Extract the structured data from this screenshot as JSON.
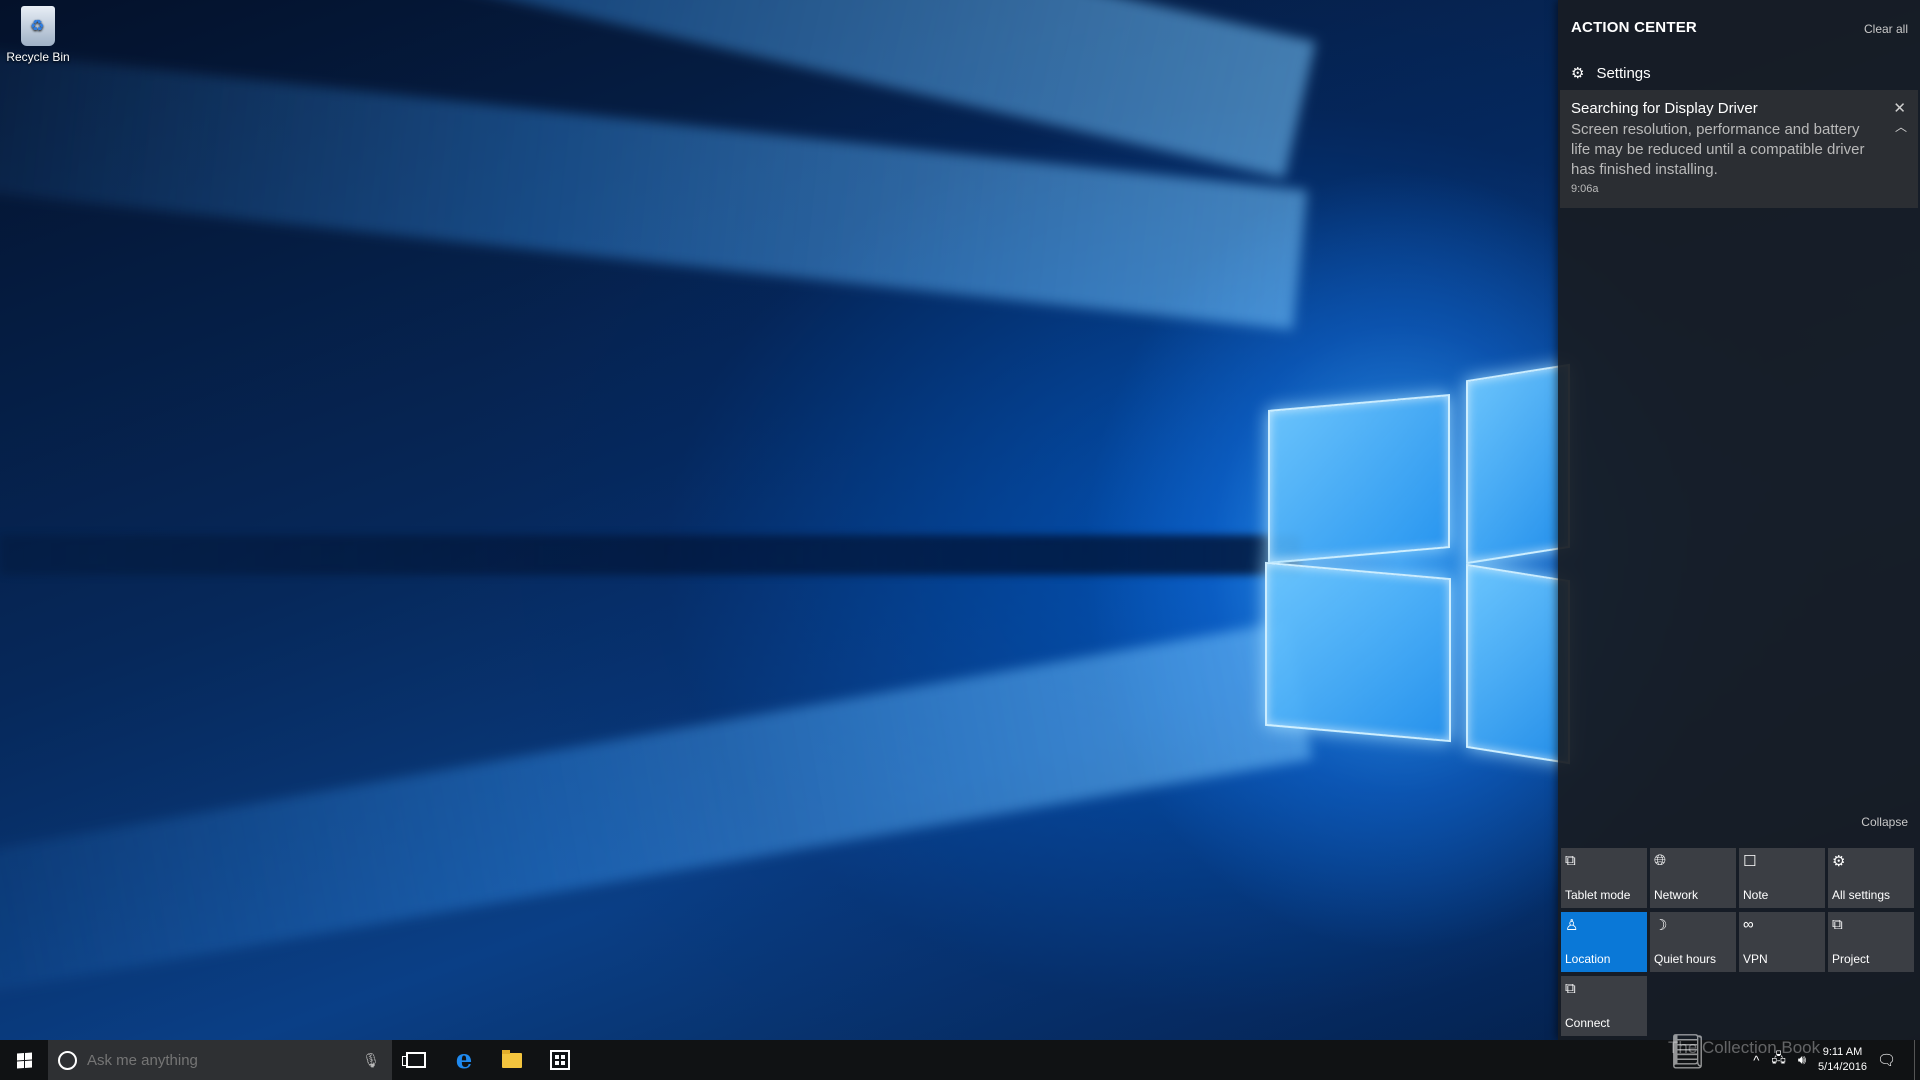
{
  "desktop": {
    "icons": [
      {
        "label": "Recycle Bin",
        "icon": "recycle-bin-icon"
      }
    ]
  },
  "action_center": {
    "title": "ACTION CENTER",
    "clear_all": "Clear all",
    "group_title": "Settings",
    "notification": {
      "title": "Searching for Display Driver",
      "body": "Screen resolution, performance and battery life may be reduced until a compatible driver has finished installing.",
      "time": "9:06a",
      "close_glyph": "✕",
      "collapse_glyph": "︿"
    },
    "collapse": "Collapse",
    "quick_actions": [
      {
        "label": "Tablet mode",
        "icon": "tablet-mode-icon",
        "glyph": "⧉",
        "active": false
      },
      {
        "label": "Network",
        "icon": "network-icon",
        "glyph": "🌐︎",
        "active": false
      },
      {
        "label": "Note",
        "icon": "note-icon",
        "glyph": "☐",
        "active": false
      },
      {
        "label": "All settings",
        "icon": "gear-icon",
        "glyph": "⚙",
        "active": false
      },
      {
        "label": "Location",
        "icon": "location-icon",
        "glyph": "♙",
        "active": true
      },
      {
        "label": "Quiet hours",
        "icon": "moon-icon",
        "glyph": "☽",
        "active": false
      },
      {
        "label": "VPN",
        "icon": "vpn-icon",
        "glyph": "∞",
        "active": false
      },
      {
        "label": "Project",
        "icon": "project-icon",
        "glyph": "⧉",
        "active": false
      },
      {
        "label": "Connect",
        "icon": "connect-icon",
        "glyph": "⧉",
        "active": false
      }
    ],
    "accent_color": "#0a78d7"
  },
  "taskbar": {
    "search_placeholder": "Ask me anything",
    "pinned": [
      {
        "name": "Task View",
        "icon": "task-view-icon"
      },
      {
        "name": "Microsoft Edge",
        "icon": "edge-icon",
        "glyph": "e"
      },
      {
        "name": "File Explorer",
        "icon": "file-explorer-icon"
      },
      {
        "name": "Store",
        "icon": "store-icon"
      }
    ],
    "clock": {
      "time": "9:11 AM",
      "date": "5/14/2016"
    },
    "watermark": "The Collection Book"
  }
}
